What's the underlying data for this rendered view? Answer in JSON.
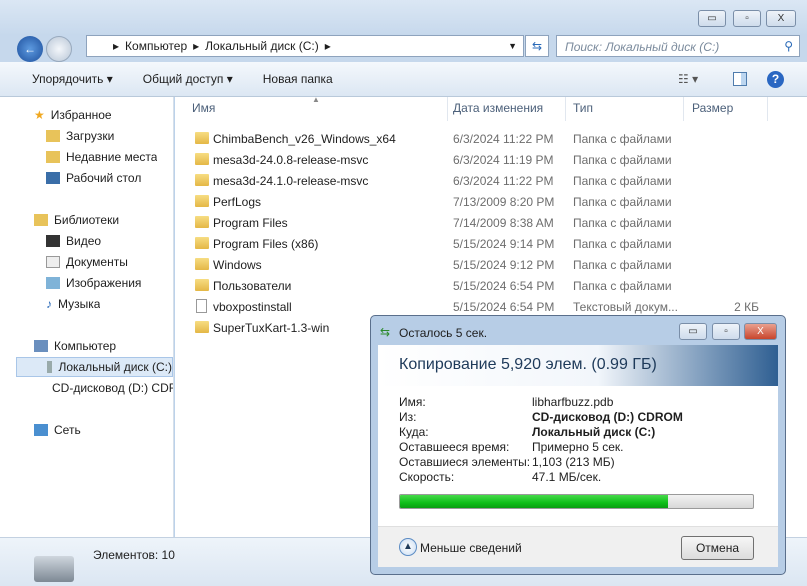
{
  "window": {
    "minimize": "▭",
    "maximize": "▫",
    "close": "X"
  },
  "address": {
    "crumbs": [
      "Компьютер",
      "Локальный диск (C:)"
    ],
    "search_placeholder": "Поиск: Локальный диск (C:)"
  },
  "toolbar": {
    "organize": "Упорядочить ▾",
    "share": "Общий доступ ▾",
    "new_folder": "Новая папка"
  },
  "sidebar": {
    "favorites": "Избранное",
    "downloads": "Загрузки",
    "recent": "Недавние места",
    "desktop": "Рабочий стол",
    "libraries": "Библиотеки",
    "video": "Видео",
    "documents": "Документы",
    "images": "Изображения",
    "music": "Музыка",
    "computer": "Компьютер",
    "local_disk": "Локальный диск (C:)",
    "cd_drive": "CD-дисковод (D:) CDROM",
    "network": "Сеть"
  },
  "columns": {
    "name": "Имя",
    "date": "Дата изменения",
    "type": "Тип",
    "size": "Размер"
  },
  "files": [
    {
      "name": "ChimbaBench_v26_Windows_x64",
      "date": "6/3/2024 11:22 PM",
      "type": "Папка с файлами",
      "size": "",
      "kind": "folder"
    },
    {
      "name": "mesa3d-24.0.8-release-msvc",
      "date": "6/3/2024 11:19 PM",
      "type": "Папка с файлами",
      "size": "",
      "kind": "folder"
    },
    {
      "name": "mesa3d-24.1.0-release-msvc",
      "date": "6/3/2024 11:22 PM",
      "type": "Папка с файлами",
      "size": "",
      "kind": "folder"
    },
    {
      "name": "PerfLogs",
      "date": "7/13/2009 8:20 PM",
      "type": "Папка с файлами",
      "size": "",
      "kind": "folder"
    },
    {
      "name": "Program Files",
      "date": "7/14/2009 8:38 AM",
      "type": "Папка с файлами",
      "size": "",
      "kind": "folder"
    },
    {
      "name": "Program Files (x86)",
      "date": "5/15/2024 9:14 PM",
      "type": "Папка с файлами",
      "size": "",
      "kind": "folder"
    },
    {
      "name": "Windows",
      "date": "5/15/2024 9:12 PM",
      "type": "Папка с файлами",
      "size": "",
      "kind": "folder"
    },
    {
      "name": "Пользователи",
      "date": "5/15/2024 6:54 PM",
      "type": "Папка с файлами",
      "size": "",
      "kind": "folder"
    },
    {
      "name": "vboxpostinstall",
      "date": "5/15/2024 6:54 PM",
      "type": "Текстовый докум...",
      "size": "2 КБ",
      "kind": "file"
    },
    {
      "name": "SuperTuxKart-1.3-win",
      "date": "",
      "type": "",
      "size": "",
      "kind": "folder"
    }
  ],
  "status": {
    "count": "Элементов: 10"
  },
  "dialog": {
    "title": "Осталось 5 сек.",
    "heading": "Копирование 5,920 элем. (0.99 ГБ)",
    "labels": [
      "Имя:",
      "Из:",
      "Куда:",
      "Оставшееся время:",
      "Оставшиеся элементы:",
      "Скорость:"
    ],
    "values": [
      "libharfbuzz.pdb",
      "CD-дисковод (D:) CDROM",
      "Локальный диск (C:)",
      "Примерно 5 сек.",
      "1,103 (213 МБ)",
      "47.1 МБ/сек."
    ],
    "progress_percent": 76,
    "less_details": "Меньше сведений",
    "cancel": "Отмена"
  }
}
